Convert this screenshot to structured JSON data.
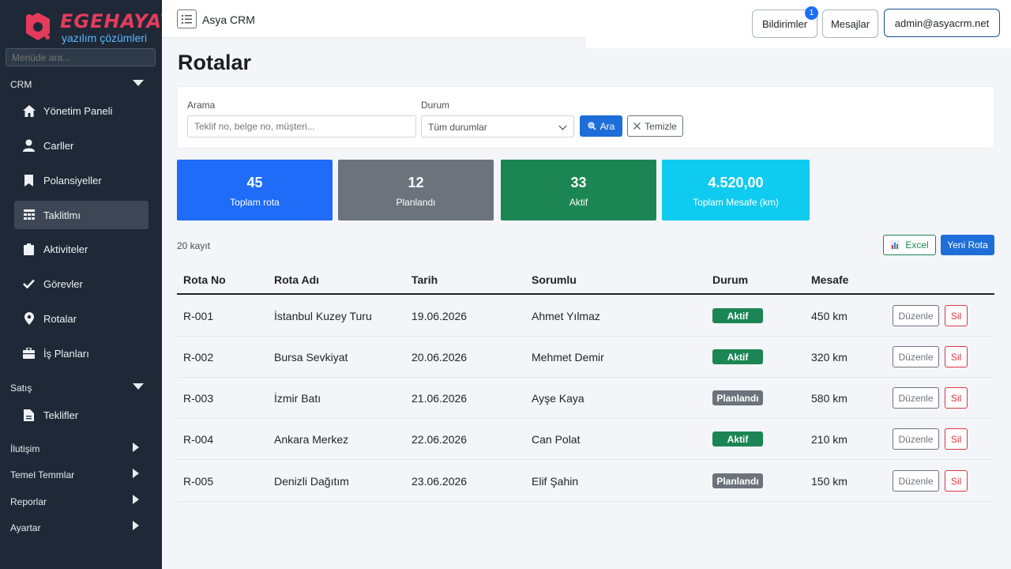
{
  "brand": {
    "title": "EGEHAYAT",
    "subtitle": "yazılım çözümleri"
  },
  "sidebar": {
    "search_placeholder": "Menüde ara...",
    "sections": [
      {
        "label": "CRM"
      },
      {
        "label": "Satış"
      },
      {
        "label": "İlutişim"
      },
      {
        "label": "Temel Temmlar"
      },
      {
        "label": "Reporlar"
      },
      {
        "label": "Ayartar"
      }
    ],
    "items": [
      {
        "label": "Yönetim Paneli",
        "icon": "home-icon"
      },
      {
        "label": "Carller",
        "icon": "user-icon"
      },
      {
        "label": "Polansiyeller",
        "icon": "bookmark-icon"
      },
      {
        "label": "Taklitlmı",
        "icon": "grid-icon"
      },
      {
        "label": "Aktiviteler",
        "icon": "clipboard-icon"
      },
      {
        "label": "Görevler",
        "icon": "check-icon"
      },
      {
        "label": "Rotalar",
        "icon": "map-pin-icon"
      },
      {
        "label": "İş Planları",
        "icon": "briefcase-icon"
      },
      {
        "label": "Teklifler",
        "icon": "document-icon"
      }
    ]
  },
  "header": {
    "app_title": "Asya CRM",
    "notifications_label": "Bildirimler",
    "notifications_count": "1",
    "messages_label": "Mesajlar",
    "user_label": "admin@asyacrm.net"
  },
  "page": {
    "title": "Rotalar"
  },
  "filters": {
    "search_label": "Arama",
    "search_placeholder": "Teklif no, belge no, müşteri...",
    "status_label": "Durum",
    "status_value": "Tüm durumlar",
    "search_button": "Ara",
    "clear_button": "Temizle"
  },
  "stats": [
    {
      "value": "45",
      "label": "Toplam rota",
      "color": "#1e6cf8"
    },
    {
      "value": "12",
      "label": "Planlandı",
      "color": "#6c737c"
    },
    {
      "value": "33",
      "label": "Aktif",
      "color": "#1c8554"
    },
    {
      "value": "4.520,00",
      "label": "Toplam Mesafe (km)",
      "color": "#0fcbef"
    }
  ],
  "table": {
    "record_count": "20 kayıt",
    "excel_button": "Excel",
    "new_button": "Yeni Rota",
    "columns": [
      "Rota No",
      "Rota Adı",
      "Tarih",
      "Sorumlu",
      "Durum",
      "Mesafe"
    ],
    "edit_label": "Düzenle",
    "delete_label": "Sil",
    "status_colors": {
      "Aktif": "#1c8554",
      "Planlandı": "#6c737c"
    },
    "rows": [
      {
        "no": "R-001",
        "name": "İstanbul Kuzey Turu",
        "date": "19.06.2026",
        "owner": "Ahmet Yılmaz",
        "status": "Aktif",
        "distance": "450 km"
      },
      {
        "no": "R-002",
        "name": "Bursa Sevkiyat",
        "date": "20.06.2026",
        "owner": "Mehmet Demir",
        "status": "Aktif",
        "distance": "320 km"
      },
      {
        "no": "R-003",
        "name": "İzmir Batı",
        "date": "21.06.2026",
        "owner": "Ayşe Kaya",
        "status": "Planlandı",
        "distance": "580 km"
      },
      {
        "no": "R-004",
        "name": "Ankara Merkez",
        "date": "22.06.2026",
        "owner": "Can Polat",
        "status": "Aktif",
        "distance": "210 km"
      },
      {
        "no": "R-005",
        "name": "Denizli Dağıtım",
        "date": "23.06.2026",
        "owner": "Elif Şahin",
        "status": "Planlandı",
        "distance": "150 km"
      }
    ]
  }
}
